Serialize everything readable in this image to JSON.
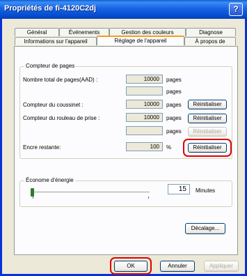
{
  "window": {
    "title": "Propriétés de fi-4120C2dj",
    "help_label": "?"
  },
  "tabs_back": [
    {
      "label": "Général"
    },
    {
      "label": "Événements"
    },
    {
      "label": "Gestion des couleurs"
    },
    {
      "label": "Diagnose"
    }
  ],
  "tabs_front": [
    {
      "label": "Informations sur l'appareil"
    },
    {
      "label": "Réglage de l'appareil"
    },
    {
      "label": "À propos de"
    }
  ],
  "page_counter": {
    "group_label": "Compteur de pages",
    "rows": [
      {
        "label": "Nombre total de pages(AAD) :",
        "value": "10000",
        "unit": "pages"
      },
      {
        "label": "",
        "value": "",
        "unit": "pages"
      },
      {
        "label": "Compteur du coussinet :",
        "value": "10000",
        "unit": "pages",
        "button": "Réinitialiser"
      },
      {
        "label": "Compteur du rouleau de prise :",
        "value": "10000",
        "unit": "pages",
        "button": "Réinitialiser"
      },
      {
        "label": "",
        "value": "",
        "unit": "pages",
        "button": "Réinitialiser"
      },
      {
        "label": "Encre restante:",
        "value": "100",
        "unit": "%",
        "button": "Réinitialiser"
      }
    ]
  },
  "energy": {
    "group_label": "Économe d'énergie",
    "value": "15",
    "unit": "Minutes",
    "slider_level_fraction": 0.02
  },
  "offset_button": "Décalage...",
  "footer": {
    "ok": "OK",
    "cancel": "Annuler",
    "apply": "Appliquer"
  },
  "colors": {
    "titlebar": "#0a5fd8",
    "highlight": "#e00000",
    "window_bg": "#ece9d8"
  }
}
